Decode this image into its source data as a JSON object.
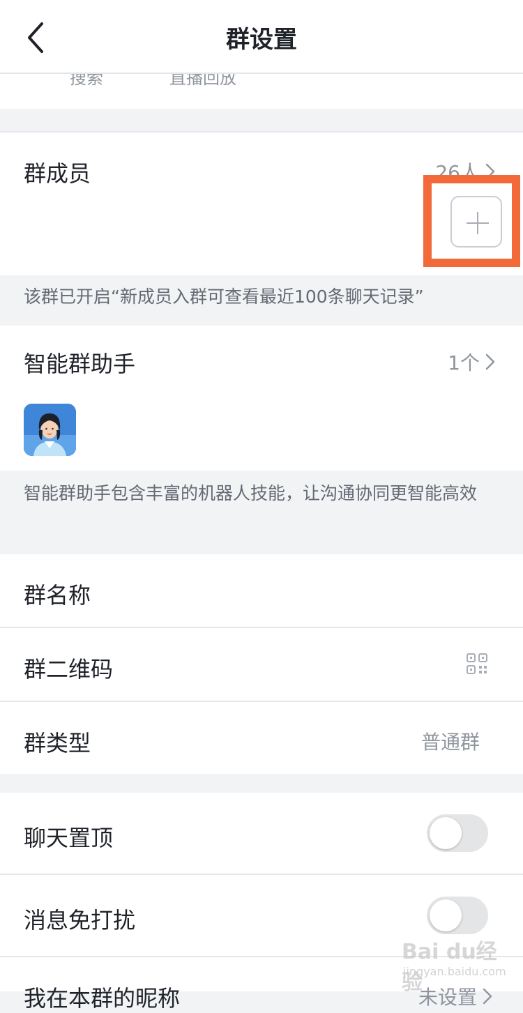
{
  "header": {
    "title": "群设置",
    "back_icon": "chevron-left-icon"
  },
  "clipped_strip": {
    "item1": "搜索",
    "item2": "直播回放"
  },
  "members": {
    "label": "群成员",
    "count": "26人",
    "add_icon": "plus-icon",
    "note": "该群已开启“新成员入群可查看最近100条聊天记录”"
  },
  "assistant": {
    "label": "智能群助手",
    "count": "1个",
    "avatar_icon": "assistant-avatar",
    "note": "智能群助手包含丰富的机器人技能，让沟通协同更智能高效"
  },
  "info": {
    "name_label": "群名称",
    "qr_label": "群二维码",
    "qr_icon": "qr-code-icon",
    "type_label": "群类型",
    "type_value": "普通群"
  },
  "settings": {
    "pin_label": "聊天置顶",
    "pin_on": false,
    "mute_label": "消息免打扰",
    "mute_on": false,
    "nickname_label": "我在本群的昵称",
    "nickname_value": "未设置"
  },
  "watermark": {
    "main": "Bai du经验",
    "sub": "jingyan.baidu.com"
  },
  "colors": {
    "highlight": "#f26a3a",
    "background": "#f2f3f5",
    "text_primary": "#1f2329",
    "text_secondary": "#8f959e"
  }
}
